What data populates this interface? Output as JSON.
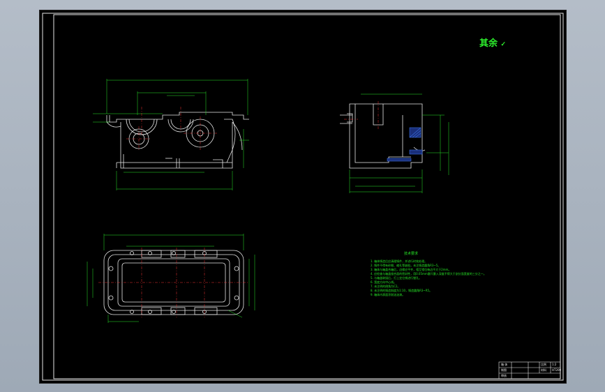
{
  "drawing": {
    "roughness_mark": "其余",
    "roughness_symbol": "✓",
    "tech_requirements": {
      "title": "技术要求",
      "items": [
        "1. 箱体铸造后应清理铸件，并进行时效处理。",
        "2. 铸件不得有砂眼、缩孔等缺陷，未注铸造圆角R3~5。",
        "3. 箱体与箱盖合箱后，边缘应平齐，相互错位每边不大于2mm。",
        "4. 应检查与箱盖接合面的密封性，用0.05mm塞尺塞入深度不得大于剖分面宽度的三分之一。",
        "5. 与箱盖联接后，打上定位销进行镗孔。",
        "6. 宽度方向中心线。",
        "7. 未注明的倒角为C2。",
        "8. 未注明的铸造斜度为1:10，铸造圆角R3~R5。",
        "9. 箱体内表面涂耐油油漆。"
      ]
    },
    "title_block": {
      "row1": [
        "箱 体",
        "",
        "比例",
        "1:2"
      ],
      "row2": [
        "制图",
        "",
        "材料",
        "HT200"
      ],
      "row3": [
        "审核",
        "",
        "",
        ""
      ]
    }
  }
}
